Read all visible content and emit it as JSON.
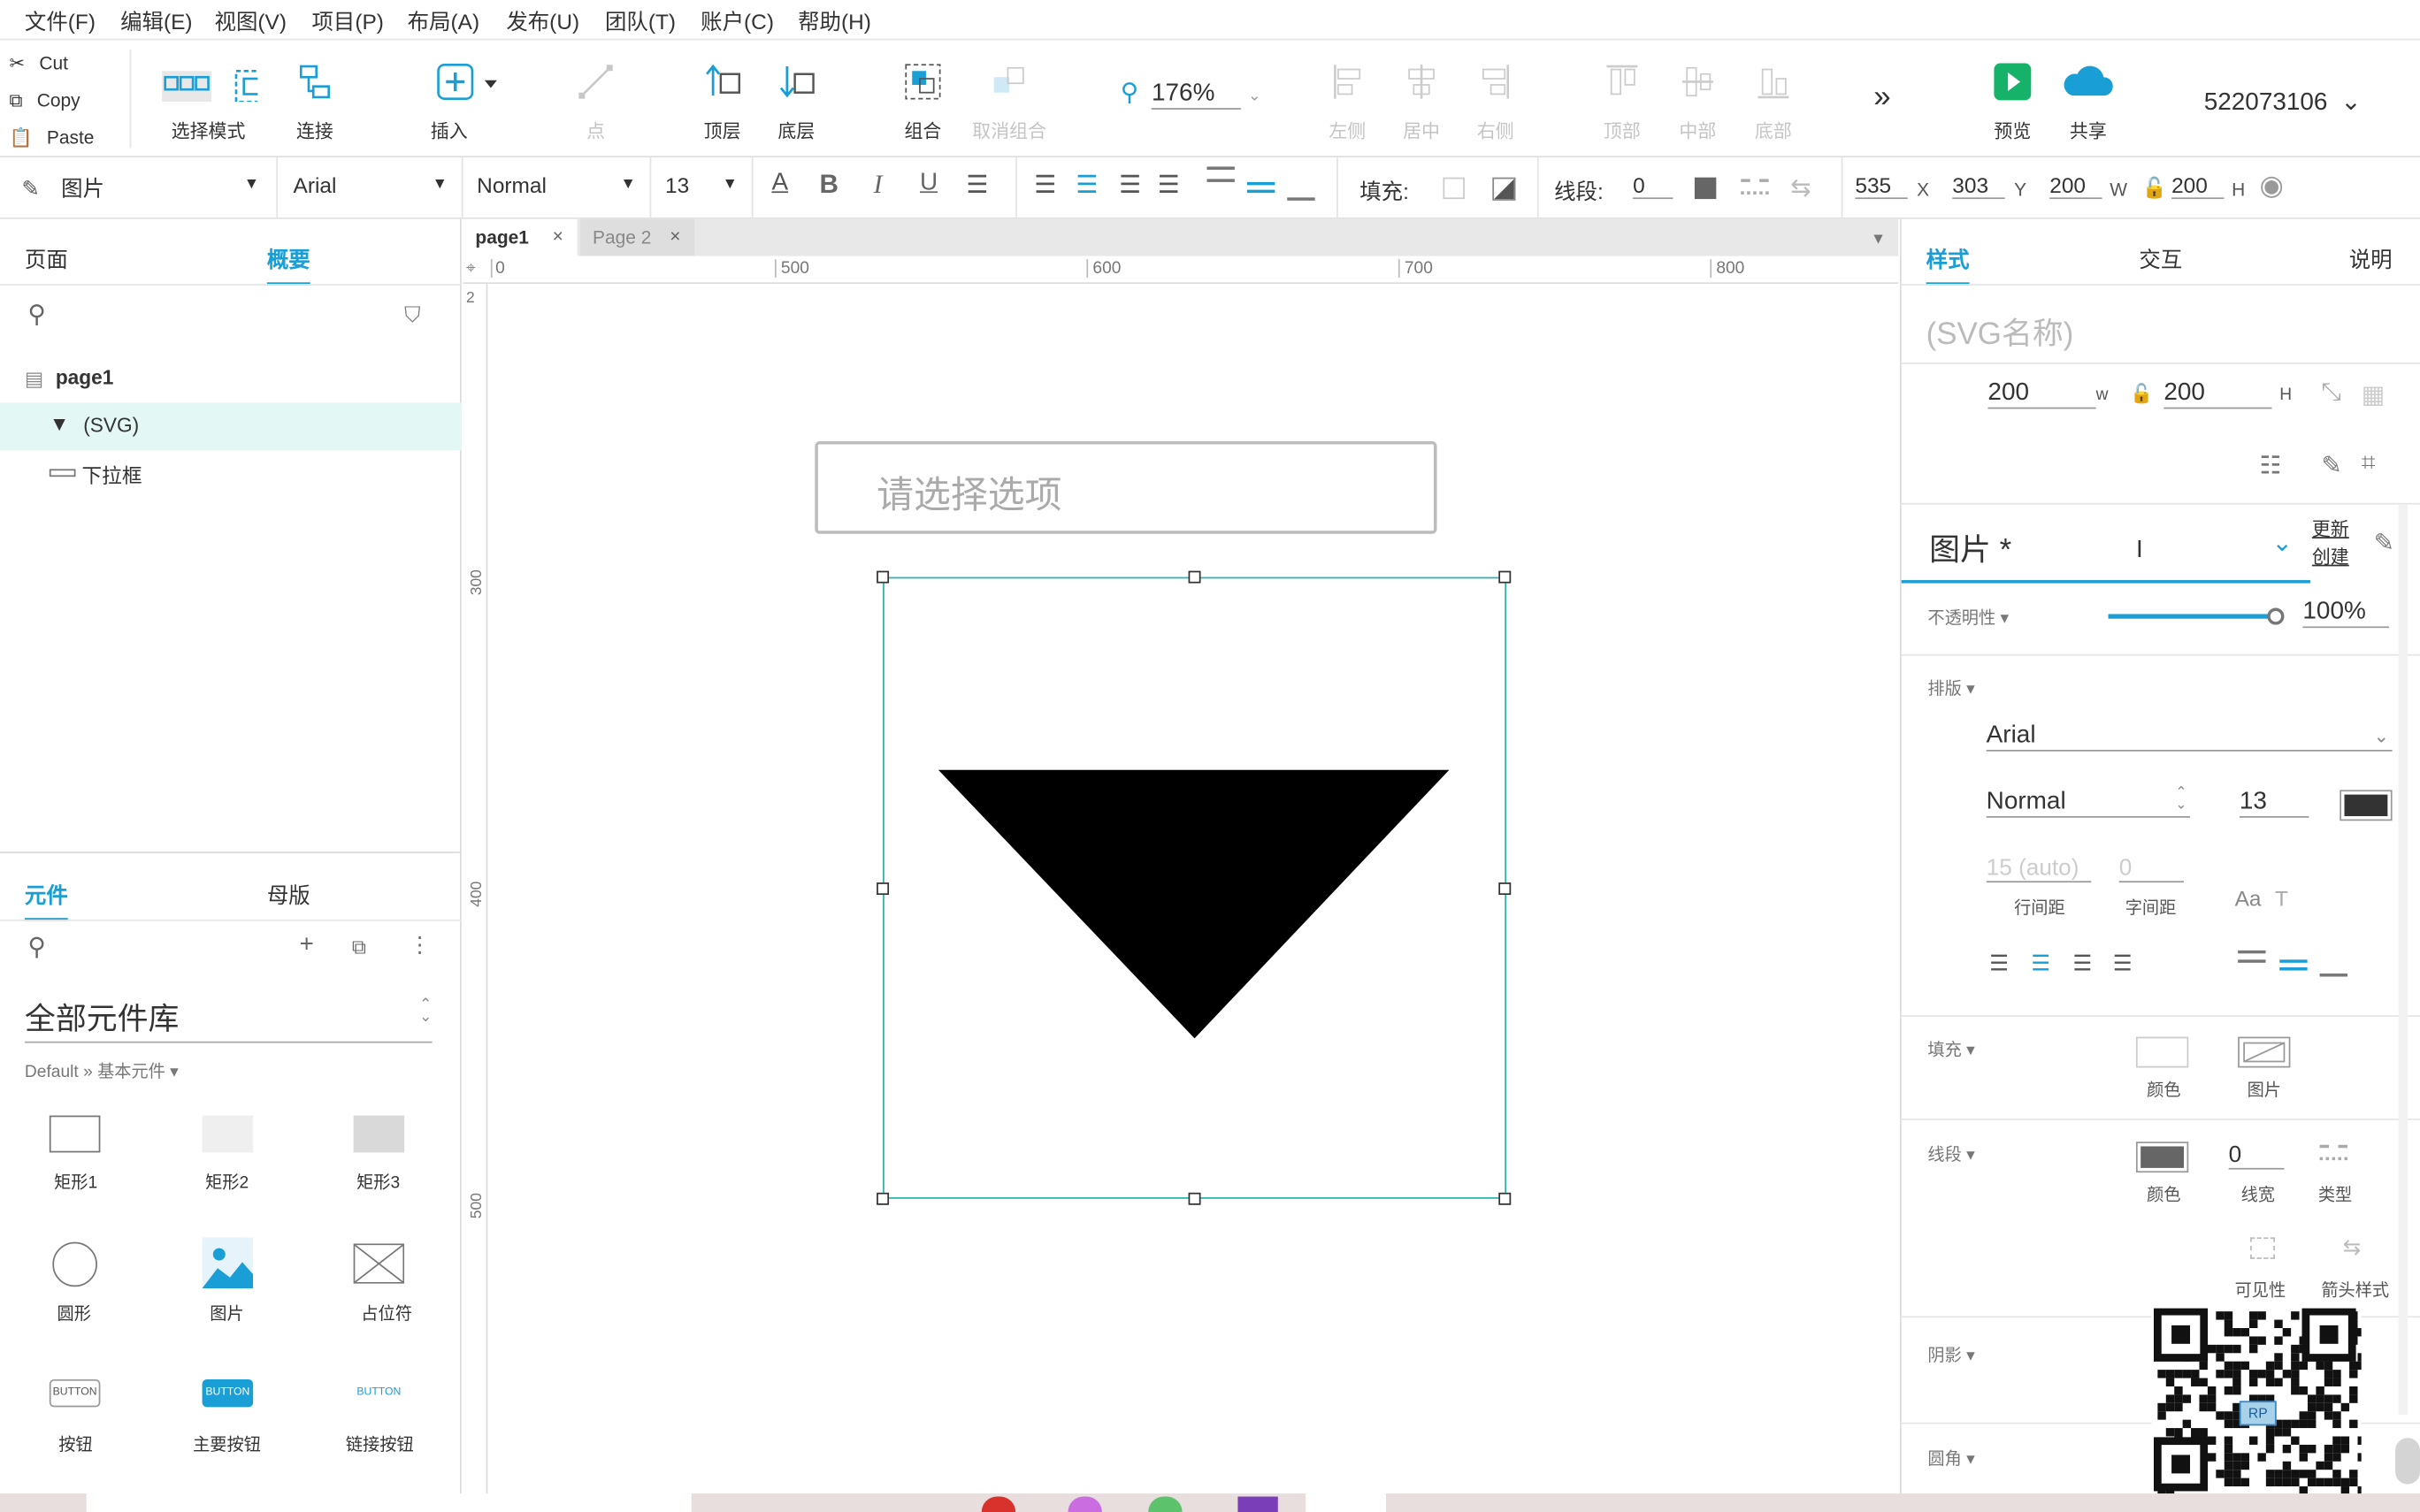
{
  "menu": [
    "文件(F)",
    "编辑(E)",
    "视图(V)",
    "项目(P)",
    "布局(A)",
    "发布(U)",
    "团队(T)",
    "账户(C)",
    "帮助(H)"
  ],
  "clipboard": {
    "cut": "Cut",
    "copy": "Copy",
    "paste": "Paste"
  },
  "toolbar": {
    "select_mode": "选择模式",
    "connect": "连接",
    "insert": "插入",
    "point": "点",
    "top_layer": "顶层",
    "bottom_layer": "底层",
    "group": "组合",
    "ungroup": "取消组合",
    "zoom": "176%",
    "align_left": "左侧",
    "align_center": "居中",
    "align_right": "右侧",
    "align_top": "顶部",
    "align_middle": "中部",
    "align_bottom": "底部",
    "preview": "预览",
    "share": "共享",
    "account": "522073106"
  },
  "format": {
    "style_name": "图片",
    "font": "Arial",
    "weight": "Normal",
    "size": "13",
    "fill_label": "填充:",
    "line_label": "线段:",
    "line_value": "0",
    "x": "535",
    "x_label": "X",
    "y": "303",
    "y_label": "Y",
    "w": "200",
    "w_label": "W",
    "h": "200",
    "h_label": "H"
  },
  "left": {
    "tab_pages": "页面",
    "tab_outline": "概要",
    "tree": [
      {
        "label": "page1"
      },
      {
        "label": "(SVG)"
      },
      {
        "label": "下拉框"
      }
    ],
    "lib_tab_widgets": "元件",
    "lib_tab_masters": "母版",
    "library_name": "全部元件库",
    "library_path": "Default » 基本元件 ▾",
    "widgets": [
      {
        "label": "矩形1"
      },
      {
        "label": "矩形2"
      },
      {
        "label": "矩形3"
      },
      {
        "label": "圆形"
      },
      {
        "label": "图片"
      },
      {
        "label": "占位符"
      },
      {
        "label": "按钮"
      },
      {
        "label": "主要按钮"
      },
      {
        "label": "链接按钮"
      }
    ],
    "button_text": "BUTTON"
  },
  "tabs": {
    "page1": "page1",
    "page2": "Page 2"
  },
  "ruler": {
    "h": [
      "0",
      "500",
      "600",
      "700",
      "800"
    ],
    "v": [
      "2",
      "300",
      "400",
      "500"
    ]
  },
  "canvas": {
    "dropdown_placeholder": "请选择选项"
  },
  "right": {
    "tab_style": "样式",
    "tab_interact": "交互",
    "tab_notes": "说明",
    "name_placeholder": "(SVG名称)",
    "w": "200",
    "w_label": "w",
    "h": "200",
    "h_label": "H",
    "style_name": "图片 *",
    "update": "更新",
    "create": "创建",
    "opacity_label": "不透明性 ▾",
    "opacity": "100%",
    "opacity_value": 1.0,
    "typography_label": "排版 ▾",
    "font": "Arial",
    "weight": "Normal",
    "size": "13",
    "line_height": "15 (auto)",
    "letter_spacing": "0",
    "line_height_label": "行间距",
    "letter_spacing_label": "字间距",
    "fill_label": "填充 ▾",
    "fill_color_label": "颜色",
    "fill_image_label": "图片",
    "border_label": "线段 ▾",
    "border_color_label": "颜色",
    "border_width": "0",
    "border_width_label": "线宽",
    "border_type_label": "类型",
    "visibility_label": "可见性",
    "arrow_label": "箭头样式",
    "shadow_label": "阴影 ▾",
    "corner_label": "圆角 ▾",
    "qr_badge": "RP"
  },
  "colors": {
    "accent": "#1a9ed6",
    "selection": "#2ab3b0",
    "tree_highlight": "#e3f7f5",
    "triangle": "#000000"
  }
}
